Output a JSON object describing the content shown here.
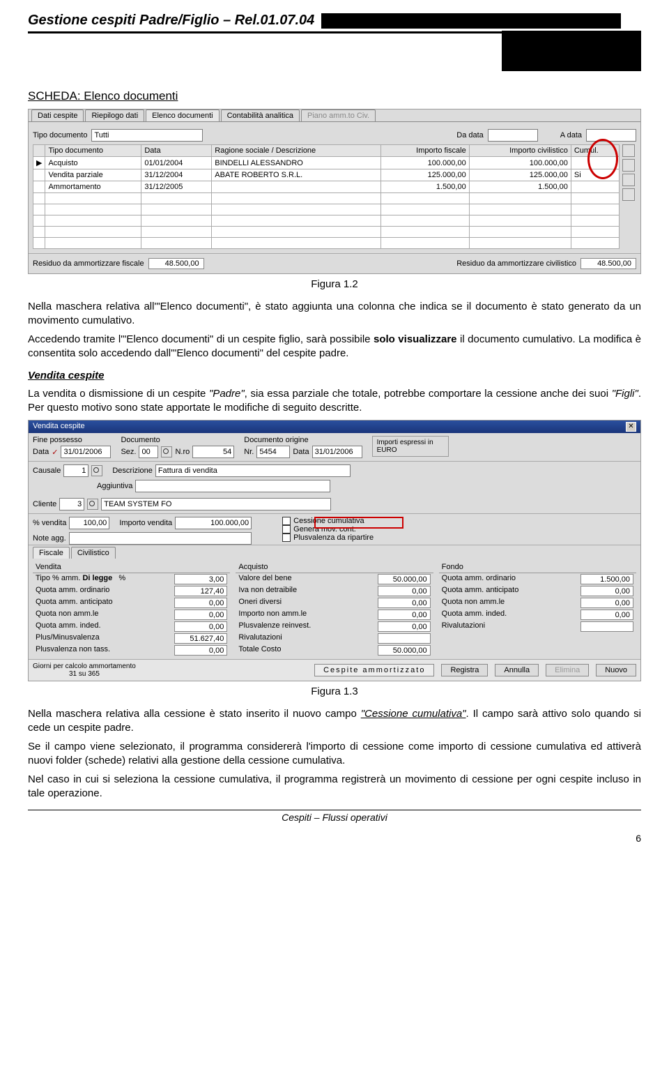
{
  "doc": {
    "title": "Gestione cespiti Padre/Figlio – Rel.01.07.04",
    "section": "SCHEDA: Elenco documenti",
    "fig1": "Figura 1.2",
    "p1": "Nella maschera relativa all'\"Elenco documenti\", è stato aggiunta una colonna che indica se il documento è stato generato da un movimento cumulativo.",
    "p2a": "Accedendo tramite l'\"Elenco documenti\" di un cespite figlio, sarà possibile ",
    "p2b": "solo visualizzare",
    "p2c": " il documento cumulativo. La modifica è consentita solo accedendo dall'\"Elenco documenti\" del cespite padre.",
    "subh": "Vendita cespite",
    "p3a": "La vendita o dismissione di un cespite ",
    "p3b": "\"Padre\"",
    "p3c": ", sia essa parziale che totale, potrebbe comportare la cessione anche dei suoi ",
    "p3d": "\"Figli\"",
    "p3e": ". Per questo motivo sono state apportate le modifiche di seguito descritte.",
    "fig2": "Figura 1.3",
    "p4a": "Nella maschera relativa alla cessione è stato inserito il nuovo campo ",
    "p4b": "\"Cessione cumulativa\"",
    "p4c": ". Il campo sarà attivo solo quando si cede un cespite padre.",
    "p5": "Se il campo viene selezionato, il programma considererà l'importo di cessione come importo di cessione cumulativa ed attiverà nuovi folder (schede) relativi alla gestione della cessione cumulativa.",
    "p6": "Nel caso in cui si seleziona la cessione cumulativa, il programma registrerà un movimento di cessione per ogni cespite incluso in tale operazione.",
    "footer_c": "Cespiti – Flussi operativi",
    "pagenum": "6"
  },
  "scr1": {
    "tabs": [
      "Dati cespite",
      "Riepilogo dati",
      "Elenco documenti",
      "Contabilità analitica",
      "Piano amm.to Civ."
    ],
    "tipo_doc_label": "Tipo documento",
    "tipo_doc_value": "Tutti",
    "da_data_label": "Da data",
    "a_data_label": "A data",
    "headers": [
      "Tipo documento",
      "Data",
      "Ragione sociale / Descrizione",
      "Importo fiscale",
      "Importo civilistico",
      "Cumul."
    ],
    "rows": [
      {
        "tipo": "Acquisto",
        "data": "01/01/2004",
        "rag": "BINDELLI ALESSANDRO",
        "fisc": "100.000,00",
        "civ": "100.000,00",
        "cum": ""
      },
      {
        "tipo": "Vendita parziale",
        "data": "31/12/2004",
        "rag": "ABATE ROBERTO S.R.L.",
        "fisc": "125.000,00",
        "civ": "125.000,00",
        "cum": "Si"
      },
      {
        "tipo": "Ammortamento",
        "data": "31/12/2005",
        "rag": "",
        "fisc": "1.500,00",
        "civ": "1.500,00",
        "cum": ""
      }
    ],
    "res_fisc_label": "Residuo da ammortizzare fiscale",
    "res_fisc_val": "48.500,00",
    "res_civ_label": "Residuo da ammortizzare civilistico",
    "res_civ_val": "48.500,00"
  },
  "scr2": {
    "title": "Vendita cespite",
    "top": {
      "fine_label": "Fine possesso",
      "data_label": "Data",
      "data_val": "31/01/2006",
      "doc_label": "Documento",
      "sez_label": "Sez.",
      "sez_val": "00",
      "nro_label": "N.ro",
      "nro_val": "54",
      "orig_label": "Documento origine",
      "nr_label": "Nr.",
      "nr_val": "5454",
      "data2_label": "Data",
      "data2_val": "31/01/2006",
      "euro_label": "Importi espressi in EURO"
    },
    "caus": {
      "label": "Causale",
      "val": "1",
      "desc_label": "Descrizione",
      "desc_val": "Fattura di vendita",
      "agg_label": "Aggiuntiva"
    },
    "cli": {
      "label": "Cliente",
      "val": "3",
      "name": "TEAM SYSTEM FO"
    },
    "pct": {
      "label": "% vendita",
      "val": "100,00",
      "imp_label": "Importo vendita",
      "imp_val": "100.000,00"
    },
    "chk": {
      "cessione": "Cessione cumulativa",
      "mov": "Genera mov. cont.",
      "plus": "Plusvalenza da ripartire"
    },
    "note_label": "Note agg.",
    "tabs2": [
      "Fiscale",
      "Civilistico"
    ],
    "col_v": "Vendita",
    "col_a": "Acquisto",
    "col_f": "Fondo",
    "v": {
      "tipo_label": "Tipo % amm.",
      "tipo_val": "Di legge",
      "pct_label": "%",
      "pct_val": "3,00",
      "quota_ord": "Quota amm. ordinario",
      "quota_ord_v": "127,40",
      "quota_ant": "Quota amm. anticipato",
      "quota_ant_v": "0,00",
      "quota_non": "Quota non amm.le",
      "quota_non_v": "0,00",
      "quota_ind": "Quota amm. inded.",
      "quota_ind_v": "0,00",
      "plusmin": "Plus/Minusvalenza",
      "plusmin_v": "51.627,40",
      "plusnt": "Plusvalenza non tass.",
      "plusnt_v": "0,00"
    },
    "a": {
      "valore": "Valore del bene",
      "valore_v": "50.000,00",
      "iva": "Iva non detraibile",
      "iva_v": "0,00",
      "oneri": "Oneri diversi",
      "oneri_v": "0,00",
      "impna": "Importo non amm.le",
      "impna_v": "0,00",
      "plusrv": "Plusvalenze reinvest.",
      "plusrv_v": "0,00",
      "rival": "Rivalutazioni",
      "rival_v": "",
      "totc": "Totale Costo",
      "totc_v": "50.000,00"
    },
    "f": {
      "qord": "Quota amm. ordinario",
      "qord_v": "1.500,00",
      "qant": "Quota amm. anticipato",
      "qant_v": "0,00",
      "qnon": "Quota non amm.le",
      "qnon_v": "0,00",
      "qind": "Quota amm. inded.",
      "qind_v": "0,00",
      "riv": "Rivalutazioni",
      "riv_v": ""
    },
    "bottom": {
      "giorni_label": "Giorni per calcolo ammortamento",
      "giorni_val": "31 su 365",
      "amm": "Cespite ammortizzato",
      "registra": "Registra",
      "annulla": "Annulla",
      "elimina": "Elimina",
      "nuovo": "Nuovo"
    }
  }
}
